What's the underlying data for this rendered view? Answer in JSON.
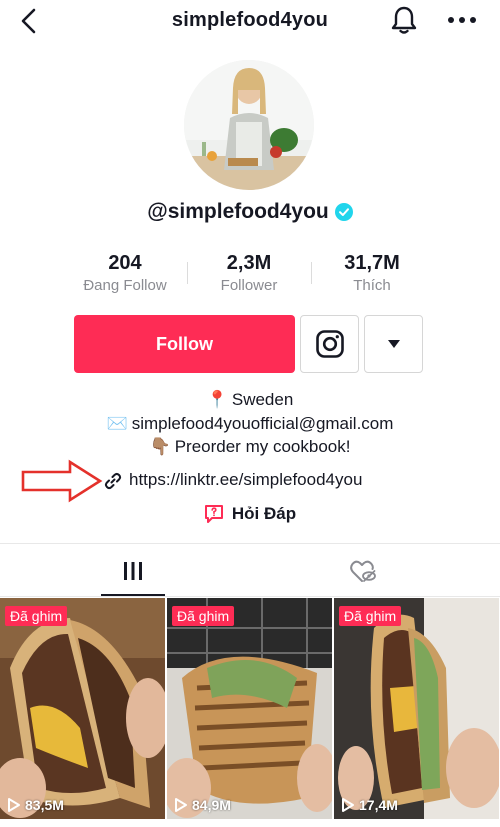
{
  "header": {
    "title": "simplefood4you",
    "back_icon": "chevron-left-icon",
    "bell_icon": "bell-icon",
    "more_icon": "more-horizontal-icon"
  },
  "profile": {
    "handle": "@simplefood4you",
    "verified": true,
    "verified_color": "#20d5ec"
  },
  "stats": [
    {
      "value": "204",
      "label": "Đang Follow"
    },
    {
      "value": "2,3M",
      "label": "Follower"
    },
    {
      "value": "31,7M",
      "label": "Thích"
    }
  ],
  "actions": {
    "follow_label": "Follow",
    "follow_color": "#fe2c55",
    "instagram_icon": "instagram-icon",
    "dropdown_icon": "caret-down-icon"
  },
  "bio": {
    "location_emoji": "📍",
    "location": "Sweden",
    "email_emoji": "✉️",
    "email": "simplefood4youofficial@gmail.com",
    "preorder_emoji": "👇🏽",
    "preorder": "Preorder my cookbook!",
    "link": "https://linktr.ee/simplefood4you",
    "qa_label": "Hỏi Đáp"
  },
  "tabs": [
    {
      "icon": "videos-grid-icon",
      "active": true
    },
    {
      "icon": "liked-hidden-icon",
      "active": false
    }
  ],
  "videos": [
    {
      "pinned_label": "Đã ghim",
      "views": "83,5M"
    },
    {
      "pinned_label": "Đã ghim",
      "views": "84,9M"
    },
    {
      "pinned_label": "Đã ghim",
      "views": "17,4M"
    }
  ]
}
